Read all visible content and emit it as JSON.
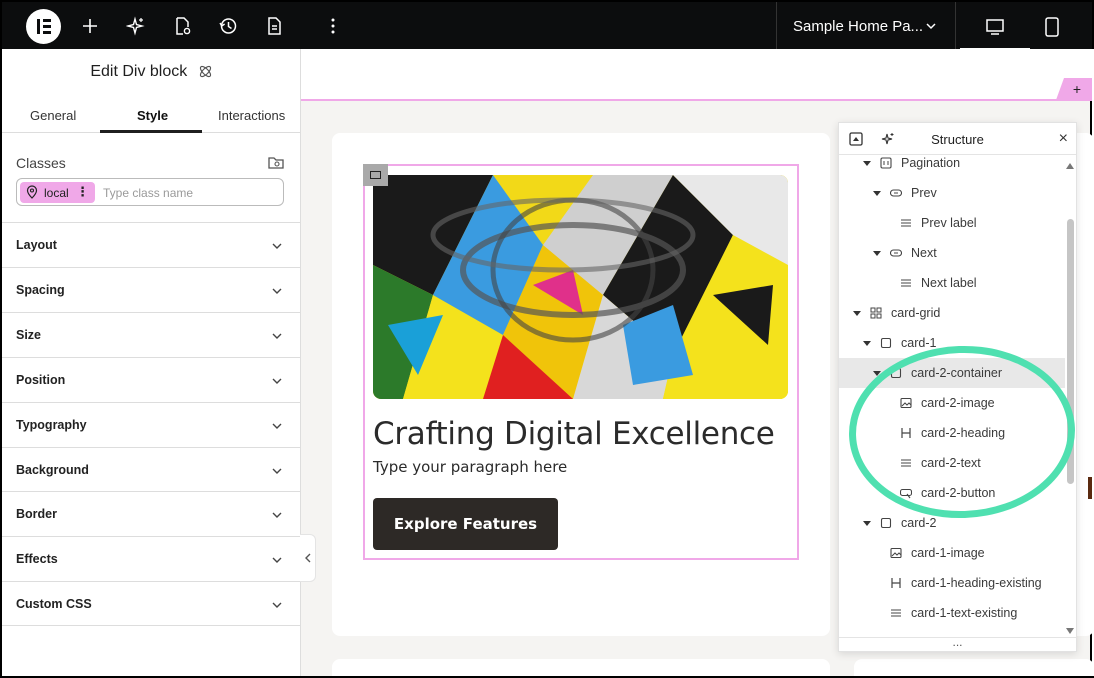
{
  "topbar": {
    "logo_name": "elementor-logo",
    "icons": [
      "add-icon",
      "ai-sparkle-icon",
      "page-settings-icon",
      "history-icon",
      "document-icon",
      "more-vertical-icon"
    ],
    "page_name": "Sample Home Pa...",
    "devices": [
      "desktop-icon",
      "mobile-icon"
    ]
  },
  "panel": {
    "title": "Edit Div block",
    "tabs": [
      {
        "label": "General"
      },
      {
        "label": "Style"
      },
      {
        "label": "Interactions"
      }
    ],
    "active_tab": "Style",
    "classes_label": "Classes",
    "class_chip": "local",
    "class_placeholder": "Type class name",
    "sections": [
      {
        "label": "Layout"
      },
      {
        "label": "Spacing"
      },
      {
        "label": "Size"
      },
      {
        "label": "Position"
      },
      {
        "label": "Typography"
      },
      {
        "label": "Background"
      },
      {
        "label": "Border"
      },
      {
        "label": "Effects"
      },
      {
        "label": "Custom CSS"
      }
    ]
  },
  "canvas": {
    "plus": "+",
    "card": {
      "heading": "Crafting Digital Excellence",
      "paragraph": "Type your paragraph here",
      "button": "Explore Features"
    }
  },
  "structure": {
    "title": "Structure",
    "close": "×",
    "footer": "...",
    "nodes": [
      {
        "label": "Pagination",
        "icon": "pagination-icon",
        "expanded": true
      },
      {
        "label": "Prev",
        "icon": "button-icon",
        "expanded": true
      },
      {
        "label": "Prev label",
        "icon": "text-lines-icon"
      },
      {
        "label": "Next",
        "icon": "button-icon",
        "expanded": true
      },
      {
        "label": "Next label",
        "icon": "text-lines-icon"
      },
      {
        "label": "card-grid",
        "icon": "grid-icon",
        "expanded": true
      },
      {
        "label": "card-1",
        "icon": "div-block-icon",
        "expanded": true
      },
      {
        "label": "card-2-container",
        "icon": "div-block-icon",
        "expanded": true,
        "selected": true
      },
      {
        "label": "card-2-image",
        "icon": "image-icon"
      },
      {
        "label": "card-2-heading",
        "icon": "heading-icon"
      },
      {
        "label": "card-2-text",
        "icon": "text-lines-icon"
      },
      {
        "label": "card-2-button",
        "icon": "button-cursor-icon"
      },
      {
        "label": "card-2",
        "icon": "div-block-icon",
        "expanded": true
      },
      {
        "label": "card-1-image",
        "icon": "image-icon"
      },
      {
        "label": "card-1-heading-existing",
        "icon": "heading-icon"
      },
      {
        "label": "card-1-text-existing",
        "icon": "text-lines-icon"
      }
    ]
  },
  "colors": {
    "highlight_ellipse": "#4fe0b0",
    "selection_pink": "#f0a8e8",
    "button_dark": "#2d2926"
  }
}
